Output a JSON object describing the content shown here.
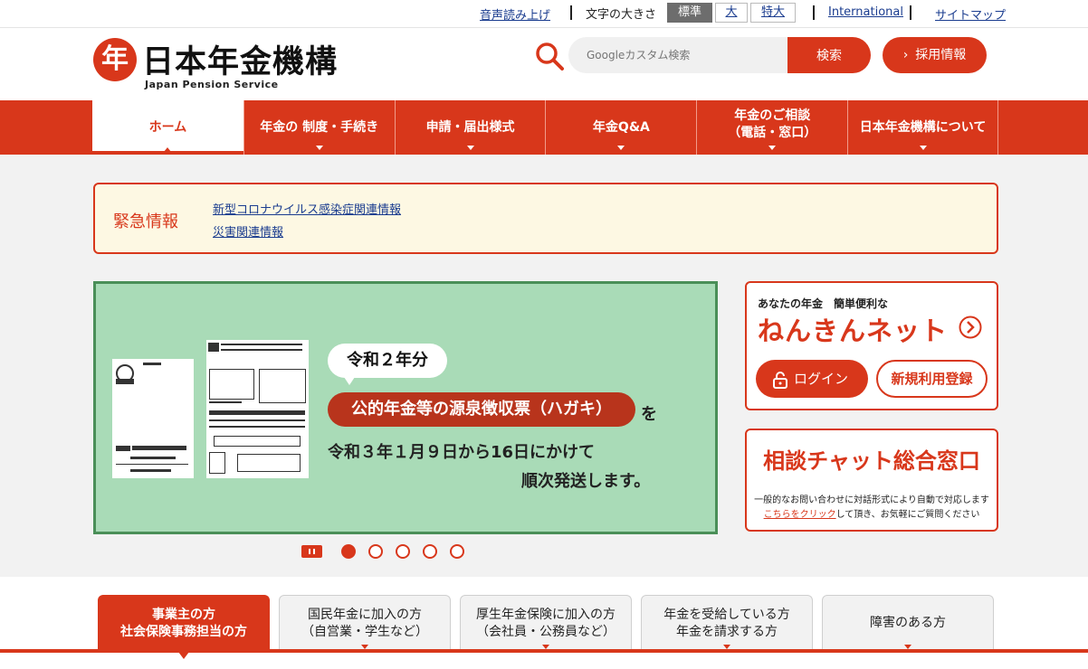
{
  "utility": {
    "read_aloud": "音声読み上げ",
    "font_size_label": "文字の大きさ",
    "font_sizes": [
      "標準",
      "大",
      "特大"
    ],
    "international": "International",
    "sitemap": "サイトマップ"
  },
  "header": {
    "logo_mark": "年",
    "logo_jp": "日本年金機構",
    "logo_en": "Japan Pension Service",
    "search_placeholder": "Googleカスタム検索",
    "search_button": "検索",
    "recruit": "採用情報"
  },
  "nav": {
    "items": [
      {
        "label": "ホーム"
      },
      {
        "label": "年金の 制度・手続き"
      },
      {
        "label": "申請・届出様式"
      },
      {
        "label": "年金Q&A"
      },
      {
        "label_line1": "年金のご相談",
        "label_line2": "（電話・窓口）"
      },
      {
        "label": "日本年金機構について"
      }
    ]
  },
  "emergency": {
    "title": "緊急情報",
    "links": [
      "新型コロナウイルス感染症関連情報",
      "災害関連情報"
    ]
  },
  "banner": {
    "year_badge": "令和２年分",
    "highlight": "公的年金等の源泉徴収票（ハガキ）",
    "particle": "を",
    "line1": "令和３年１月９日から16日にかけて",
    "line2": "順次発送します。",
    "slide_count": 5,
    "active_slide": 1
  },
  "nenkin_net": {
    "subtitle": "あなたの年金　簡単便利な",
    "name": "ねんきんネット",
    "login": "ログイン",
    "register": "新規利用登録"
  },
  "chat": {
    "title": "相談チャット総合窓口",
    "desc_line1": "一般的なお問い合わせに対話形式により自動で対応します",
    "desc_link": "こちらをクリック",
    "desc_rest": "して頂き、お気軽にご質問ください"
  },
  "tabs": [
    {
      "line1": "事業主の方",
      "line2": "社会保険事務担当の方"
    },
    {
      "line1": "国民年金に加入の方",
      "line2": "（自営業・学生など）"
    },
    {
      "line1": "厚生年金保険に加入の方",
      "line2": "（会社員・公務員など）"
    },
    {
      "line1": "年金を受給している方",
      "line2": "年金を請求する方"
    },
    {
      "line1": "障害のある方",
      "line2": ""
    }
  ],
  "colors": {
    "brand_red": "#d8371b",
    "banner_green": "#a9dbb7",
    "emergency_bg": "#fdf8e3",
    "link_blue": "#1a3c8f"
  },
  "icons": [
    "search-icon",
    "chevron-right-icon",
    "lock-icon",
    "pause-icon",
    "caret-down-icon"
  ]
}
